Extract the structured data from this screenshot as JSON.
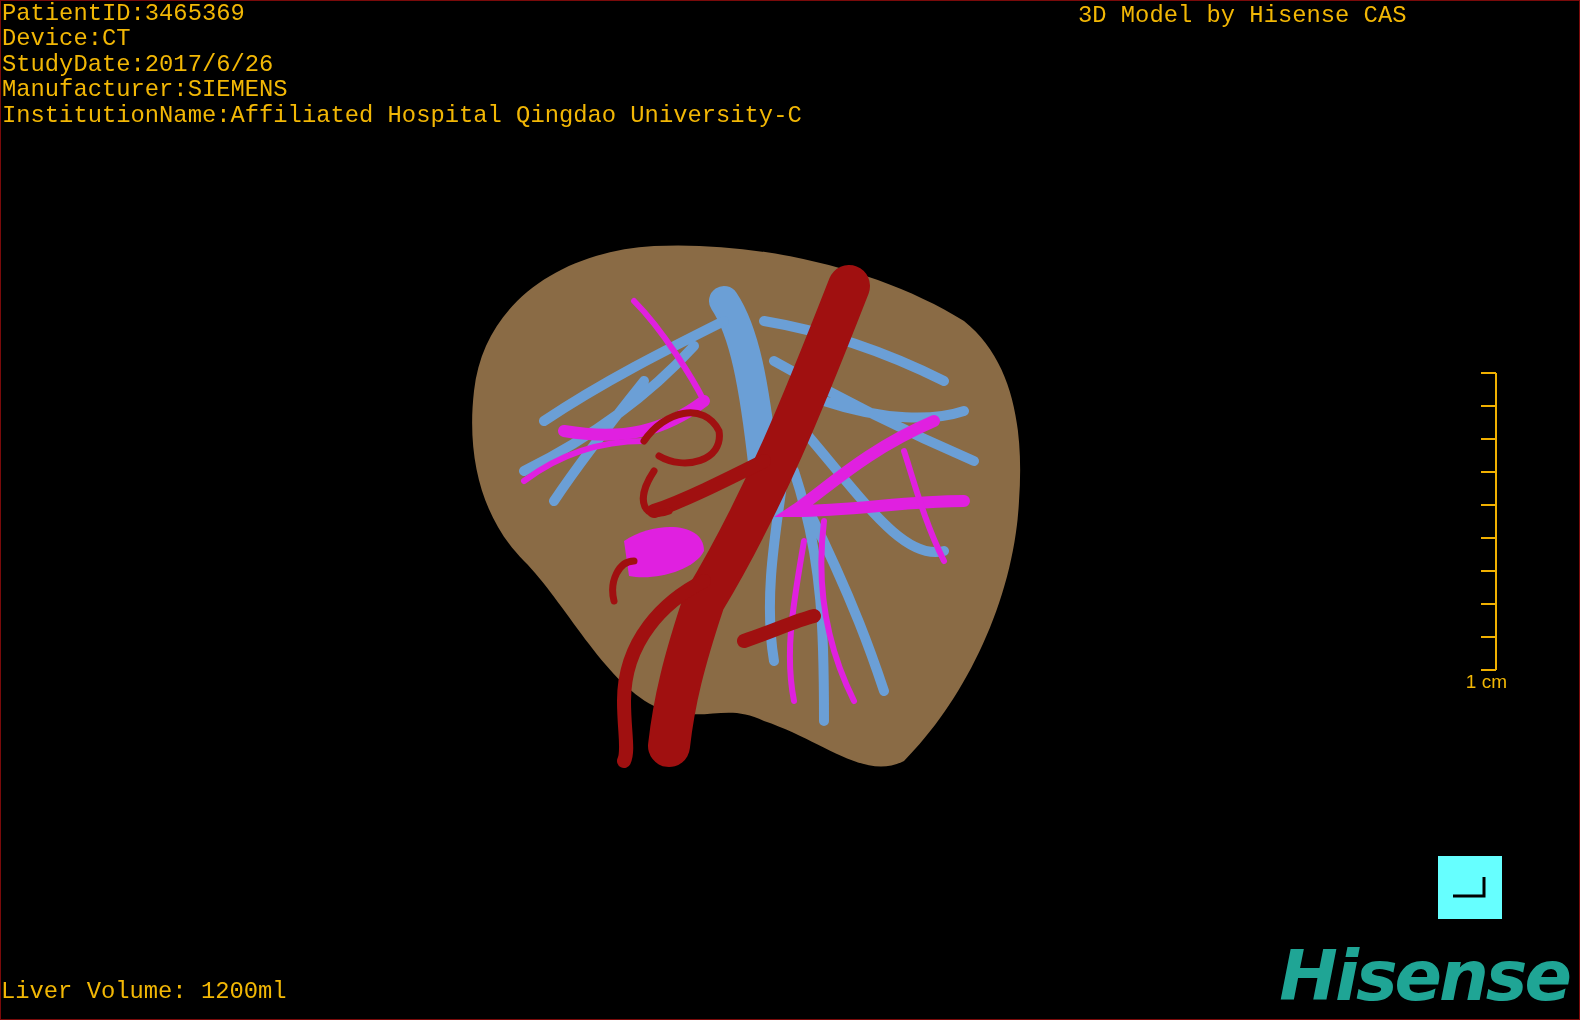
{
  "info_lines": [
    "PatientID:3465369",
    "Device:CT",
    "StudyDate:2017/6/26",
    "Manufacturer:SIEMENS",
    "InstitutionName:Affiliated Hospital Qingdao University-C"
  ],
  "title": "3D Model by Hisense CAS",
  "scale": {
    "label": "1 cm"
  },
  "liver_volume": "Liver Volume: 1200ml",
  "logo": "Hisense"
}
